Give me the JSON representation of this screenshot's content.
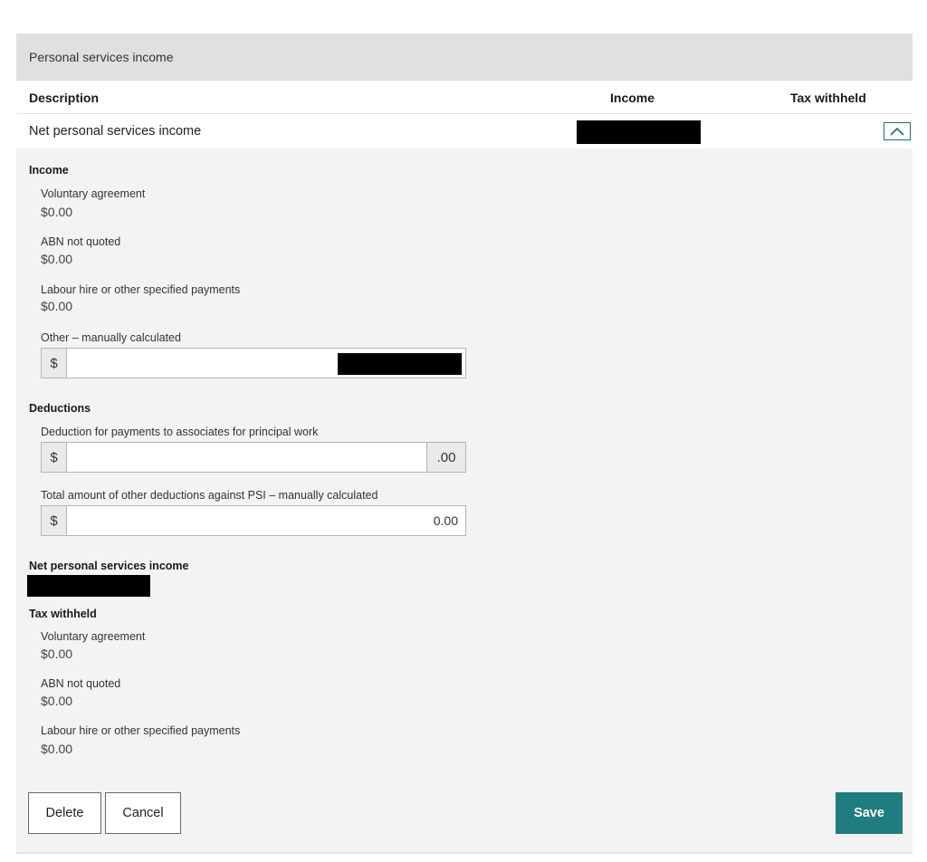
{
  "section": {
    "title": "Personal services income"
  },
  "table": {
    "headers": {
      "description": "Description",
      "income": "Income",
      "tax_withheld": "Tax withheld"
    },
    "row": {
      "description": "Net personal services income",
      "income_redacted": true
    }
  },
  "income": {
    "title": "Income",
    "items": [
      {
        "label": "Voluntary agreement",
        "value": "$0.00"
      },
      {
        "label": "ABN not quoted",
        "value": "$0.00"
      },
      {
        "label": "Labour hire or other specified payments",
        "value": "$0.00"
      }
    ],
    "other": {
      "label": "Other – manually calculated",
      "prefix": "$",
      "value": ""
    }
  },
  "deductions": {
    "title": "Deductions",
    "associates": {
      "label": "Deduction for payments to associates for principal work",
      "prefix": "$",
      "value": "",
      "suffix": ".00"
    },
    "other": {
      "label": "Total amount of other deductions against PSI – manually calculated",
      "prefix": "$",
      "value": "0.00"
    }
  },
  "net": {
    "title": "Net personal services income"
  },
  "tax_withheld": {
    "title": "Tax withheld",
    "items": [
      {
        "label": "Voluntary agreement",
        "value": "$0.00"
      },
      {
        "label": "ABN not quoted",
        "value": "$0.00"
      },
      {
        "label": "Labour hire or other specified payments",
        "value": "$0.00"
      }
    ]
  },
  "actions": {
    "delete": "Delete",
    "cancel": "Cancel",
    "save": "Save"
  },
  "colors": {
    "accent": "#1f7d7f",
    "header_bg": "#dfe1e1",
    "panel_bg": "#f3f3f3"
  },
  "icons": {
    "toggle": "chevron-up-icon"
  }
}
